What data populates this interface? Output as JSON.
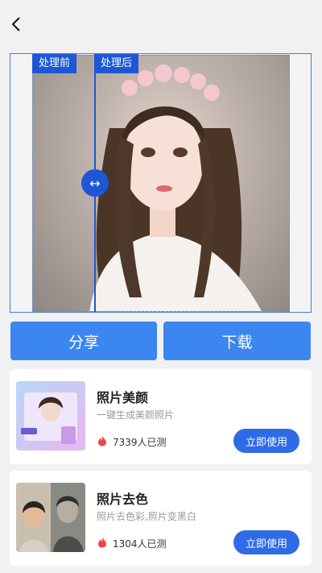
{
  "header": {
    "back_icon": "chevron-left-icon"
  },
  "compare": {
    "before_label": "处理前",
    "after_label": "处理后",
    "handle_icon": "left-right-arrows-icon",
    "handle_glyph": "↔"
  },
  "actions": {
    "share_label": "分享",
    "download_label": "下载"
  },
  "features": [
    {
      "title": "照片美颜",
      "desc": "一键生成美颜照片",
      "count": "7339人已测",
      "button": "立即使用"
    },
    {
      "title": "照片去色",
      "desc": "照片去色彩,照片变黑白",
      "count": "1304人已测",
      "button": "立即使用"
    }
  ],
  "colors": {
    "accent": "#3b86f0",
    "tag": "#1d57d6",
    "use_button": "#2f6be6",
    "fire": "#e8474c"
  }
}
